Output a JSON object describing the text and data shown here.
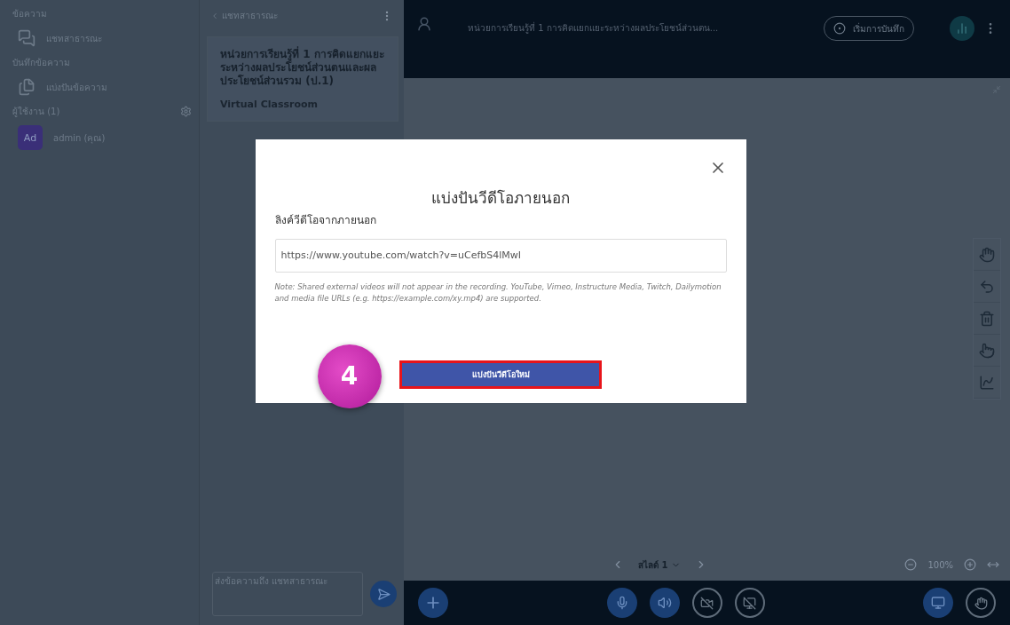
{
  "sidebar": {
    "messages_heading": "ข้อความ",
    "chat_item": "แชทสาธารณะ",
    "notes_heading": "บันทึกข้อความ",
    "notes_item": "แบ่งปันข้อความ",
    "users_heading": "ผู้ใช้งาน (1)",
    "users": [
      {
        "initials": "Ad",
        "name": "admin (คุณ)"
      }
    ]
  },
  "chat": {
    "back_label": "แชทสาธารณะ",
    "message": {
      "text": "หน่วยการเรียนรู้ที่ 1 การคิดแยกแยะระหว่างผลประโยชน์ส่วนตนและผลประโยชน์ส่วนรวม (ป.1)",
      "subtitle": "Virtual Classroom"
    },
    "input": {
      "placeholder": "ส่งข้อความถึง แชทสาธารณะ"
    }
  },
  "top_bar": {
    "title": "หน่วยการเรียนรู้ที่ 1 การคิดแยกแยะระหว่างผลประโยชน์ส่วนตน...",
    "record_label": "เริ่มการบันทึก"
  },
  "slide_nav": {
    "slide_label": "สไลด์ 1",
    "zoom": "100%"
  },
  "modal": {
    "title": "แบ่งปันวีดีโอภายนอก",
    "field_label": "ลิงค์วีดีโอจากภายนอก",
    "url": "https://www.youtube.com/watch?v=uCefbS4lMwI",
    "note": "Note: Shared external videos will not appear in the recording. YouTube, Vimeo, Instructure Media, Twitch, Dailymotion and media file URLs (e.g. https://example.com/xy.mp4) are supported.",
    "button": "แบ่งปันวีดีโอใหม่",
    "step": "4"
  }
}
